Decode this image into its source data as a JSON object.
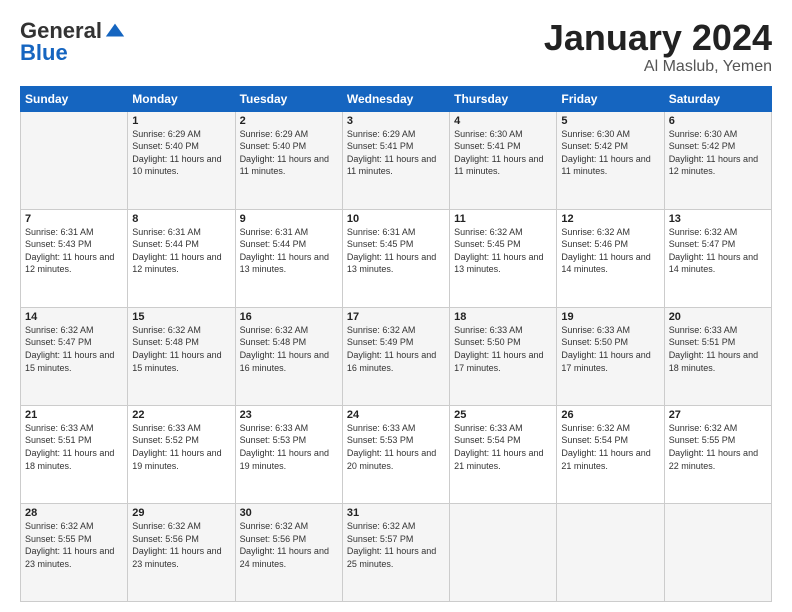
{
  "header": {
    "logo_general": "General",
    "logo_blue": "Blue",
    "month_title": "January 2024",
    "location": "Al Maslub, Yemen"
  },
  "weekdays": [
    "Sunday",
    "Monday",
    "Tuesday",
    "Wednesday",
    "Thursday",
    "Friday",
    "Saturday"
  ],
  "weeks": [
    [
      {
        "day": "",
        "sunrise": "",
        "sunset": "",
        "daylight": ""
      },
      {
        "day": "1",
        "sunrise": "Sunrise: 6:29 AM",
        "sunset": "Sunset: 5:40 PM",
        "daylight": "Daylight: 11 hours and 10 minutes."
      },
      {
        "day": "2",
        "sunrise": "Sunrise: 6:29 AM",
        "sunset": "Sunset: 5:40 PM",
        "daylight": "Daylight: 11 hours and 11 minutes."
      },
      {
        "day": "3",
        "sunrise": "Sunrise: 6:29 AM",
        "sunset": "Sunset: 5:41 PM",
        "daylight": "Daylight: 11 hours and 11 minutes."
      },
      {
        "day": "4",
        "sunrise": "Sunrise: 6:30 AM",
        "sunset": "Sunset: 5:41 PM",
        "daylight": "Daylight: 11 hours and 11 minutes."
      },
      {
        "day": "5",
        "sunrise": "Sunrise: 6:30 AM",
        "sunset": "Sunset: 5:42 PM",
        "daylight": "Daylight: 11 hours and 11 minutes."
      },
      {
        "day": "6",
        "sunrise": "Sunrise: 6:30 AM",
        "sunset": "Sunset: 5:42 PM",
        "daylight": "Daylight: 11 hours and 12 minutes."
      }
    ],
    [
      {
        "day": "7",
        "sunrise": "Sunrise: 6:31 AM",
        "sunset": "Sunset: 5:43 PM",
        "daylight": "Daylight: 11 hours and 12 minutes."
      },
      {
        "day": "8",
        "sunrise": "Sunrise: 6:31 AM",
        "sunset": "Sunset: 5:44 PM",
        "daylight": "Daylight: 11 hours and 12 minutes."
      },
      {
        "day": "9",
        "sunrise": "Sunrise: 6:31 AM",
        "sunset": "Sunset: 5:44 PM",
        "daylight": "Daylight: 11 hours and 13 minutes."
      },
      {
        "day": "10",
        "sunrise": "Sunrise: 6:31 AM",
        "sunset": "Sunset: 5:45 PM",
        "daylight": "Daylight: 11 hours and 13 minutes."
      },
      {
        "day": "11",
        "sunrise": "Sunrise: 6:32 AM",
        "sunset": "Sunset: 5:45 PM",
        "daylight": "Daylight: 11 hours and 13 minutes."
      },
      {
        "day": "12",
        "sunrise": "Sunrise: 6:32 AM",
        "sunset": "Sunset: 5:46 PM",
        "daylight": "Daylight: 11 hours and 14 minutes."
      },
      {
        "day": "13",
        "sunrise": "Sunrise: 6:32 AM",
        "sunset": "Sunset: 5:47 PM",
        "daylight": "Daylight: 11 hours and 14 minutes."
      }
    ],
    [
      {
        "day": "14",
        "sunrise": "Sunrise: 6:32 AM",
        "sunset": "Sunset: 5:47 PM",
        "daylight": "Daylight: 11 hours and 15 minutes."
      },
      {
        "day": "15",
        "sunrise": "Sunrise: 6:32 AM",
        "sunset": "Sunset: 5:48 PM",
        "daylight": "Daylight: 11 hours and 15 minutes."
      },
      {
        "day": "16",
        "sunrise": "Sunrise: 6:32 AM",
        "sunset": "Sunset: 5:48 PM",
        "daylight": "Daylight: 11 hours and 16 minutes."
      },
      {
        "day": "17",
        "sunrise": "Sunrise: 6:32 AM",
        "sunset": "Sunset: 5:49 PM",
        "daylight": "Daylight: 11 hours and 16 minutes."
      },
      {
        "day": "18",
        "sunrise": "Sunrise: 6:33 AM",
        "sunset": "Sunset: 5:50 PM",
        "daylight": "Daylight: 11 hours and 17 minutes."
      },
      {
        "day": "19",
        "sunrise": "Sunrise: 6:33 AM",
        "sunset": "Sunset: 5:50 PM",
        "daylight": "Daylight: 11 hours and 17 minutes."
      },
      {
        "day": "20",
        "sunrise": "Sunrise: 6:33 AM",
        "sunset": "Sunset: 5:51 PM",
        "daylight": "Daylight: 11 hours and 18 minutes."
      }
    ],
    [
      {
        "day": "21",
        "sunrise": "Sunrise: 6:33 AM",
        "sunset": "Sunset: 5:51 PM",
        "daylight": "Daylight: 11 hours and 18 minutes."
      },
      {
        "day": "22",
        "sunrise": "Sunrise: 6:33 AM",
        "sunset": "Sunset: 5:52 PM",
        "daylight": "Daylight: 11 hours and 19 minutes."
      },
      {
        "day": "23",
        "sunrise": "Sunrise: 6:33 AM",
        "sunset": "Sunset: 5:53 PM",
        "daylight": "Daylight: 11 hours and 19 minutes."
      },
      {
        "day": "24",
        "sunrise": "Sunrise: 6:33 AM",
        "sunset": "Sunset: 5:53 PM",
        "daylight": "Daylight: 11 hours and 20 minutes."
      },
      {
        "day": "25",
        "sunrise": "Sunrise: 6:33 AM",
        "sunset": "Sunset: 5:54 PM",
        "daylight": "Daylight: 11 hours and 21 minutes."
      },
      {
        "day": "26",
        "sunrise": "Sunrise: 6:32 AM",
        "sunset": "Sunset: 5:54 PM",
        "daylight": "Daylight: 11 hours and 21 minutes."
      },
      {
        "day": "27",
        "sunrise": "Sunrise: 6:32 AM",
        "sunset": "Sunset: 5:55 PM",
        "daylight": "Daylight: 11 hours and 22 minutes."
      }
    ],
    [
      {
        "day": "28",
        "sunrise": "Sunrise: 6:32 AM",
        "sunset": "Sunset: 5:55 PM",
        "daylight": "Daylight: 11 hours and 23 minutes."
      },
      {
        "day": "29",
        "sunrise": "Sunrise: 6:32 AM",
        "sunset": "Sunset: 5:56 PM",
        "daylight": "Daylight: 11 hours and 23 minutes."
      },
      {
        "day": "30",
        "sunrise": "Sunrise: 6:32 AM",
        "sunset": "Sunset: 5:56 PM",
        "daylight": "Daylight: 11 hours and 24 minutes."
      },
      {
        "day": "31",
        "sunrise": "Sunrise: 6:32 AM",
        "sunset": "Sunset: 5:57 PM",
        "daylight": "Daylight: 11 hours and 25 minutes."
      },
      {
        "day": "",
        "sunrise": "",
        "sunset": "",
        "daylight": ""
      },
      {
        "day": "",
        "sunrise": "",
        "sunset": "",
        "daylight": ""
      },
      {
        "day": "",
        "sunrise": "",
        "sunset": "",
        "daylight": ""
      }
    ]
  ]
}
